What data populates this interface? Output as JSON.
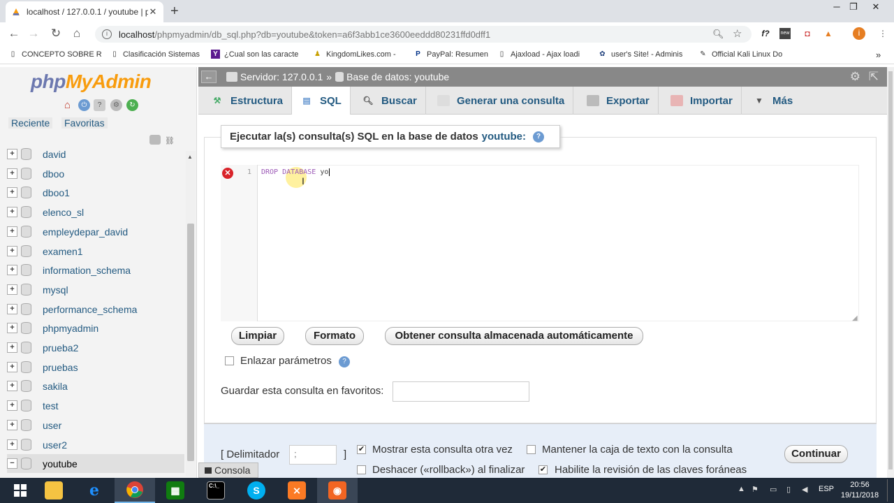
{
  "browser": {
    "tab_title": "localhost / 127.0.0.1 / youtube | p",
    "new_tab": "+",
    "url_host": "localhost",
    "url_path": "/phpmyadmin/db_sql.php?db=youtube&token=a6f3abb1ce3600eeddd80231ffd0dff1",
    "bookmarks": [
      "CONCEPTO SOBRE R",
      "Clasificación Sistemas",
      "¿Cual son las caracte",
      "KingdomLikes.com -",
      "PayPal: Resumen",
      "Ajaxload - Ajax loadi",
      "user's Site! - Adminis",
      "Official Kali Linux Do"
    ],
    "more_bookmarks": "»",
    "ext_new_badge": "new",
    "profile_initial": "i"
  },
  "logo": {
    "php": "php",
    "my": "My",
    "admin": "Admin"
  },
  "left_nav": {
    "recent": "Reciente",
    "favorites": "Favoritas",
    "databases": [
      "david",
      "dboo",
      "dboo1",
      "elenco_sl",
      "empleydepar_david",
      "examen1",
      "information_schema",
      "mysql",
      "performance_schema",
      "phpmyadmin",
      "prueba2",
      "pruebas",
      "sakila",
      "test",
      "user",
      "user2",
      "youtube"
    ],
    "selected": "youtube"
  },
  "breadcrumb": {
    "server": "Servidor: 127.0.0.1",
    "separator": "»",
    "database": "Base de datos: youtube"
  },
  "tabs": [
    "Estructura",
    "SQL",
    "Buscar",
    "Generar una consulta",
    "Exportar",
    "Importar",
    "Más"
  ],
  "active_tab": "SQL",
  "sql_panel": {
    "legend": "Ejecutar la(s) consulta(s) SQL en la base de datos",
    "db": "youtube:",
    "line_number": "1",
    "code_kw1": "DROP",
    "code_kw2": "DATABASE",
    "code_id": "yo"
  },
  "buttons": {
    "clear": "Limpiar",
    "format": "Formato",
    "get_autosaved": "Obtener consulta almacenada automáticamente",
    "continue": "Continuar"
  },
  "bind_params": {
    "label": "Enlazar parámetros",
    "checked": false
  },
  "favorite": {
    "label": "Guardar esta consulta en favoritos:",
    "value": ""
  },
  "footer": {
    "delimiter_label": "[ Delimitador",
    "delimiter_close": "]",
    "delimiter_value": ";",
    "show_query": {
      "label": "Mostrar esta consulta otra vez",
      "checked": true
    },
    "keep_textbox": {
      "label": "Mantener la caja de texto con la consulta",
      "checked": false
    },
    "rollback": {
      "label": "Deshacer («rollback») al finalizar",
      "checked": false
    },
    "fk_checks": {
      "label": "Habilite la revisión de las claves foráneas",
      "checked": true
    }
  },
  "console": "Consola",
  "taskbar": {
    "language": "ESP",
    "time": "20:56",
    "date": "19/11/2018"
  }
}
